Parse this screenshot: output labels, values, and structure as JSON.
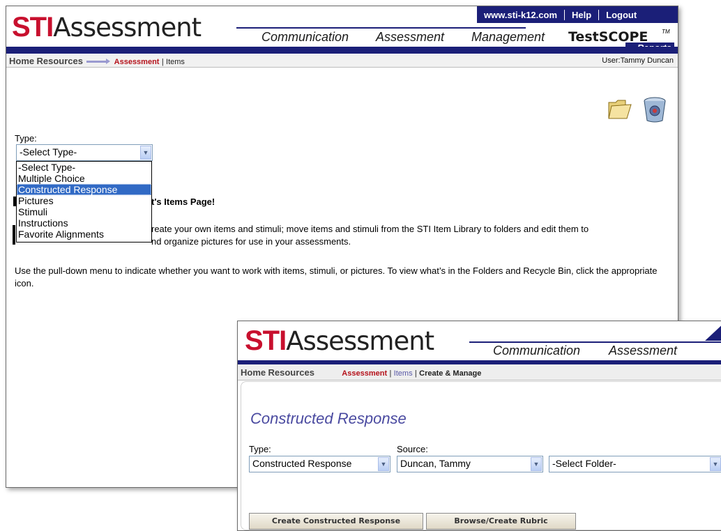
{
  "back_window": {
    "util_links": [
      "www.sti-k12.com",
      "Help",
      "Logout"
    ],
    "logo": {
      "sti": "STI",
      "assessment": "Assessment"
    },
    "top_nav": [
      "Communication",
      "Assessment",
      "Management",
      "TestSCOPE",
      "Reports"
    ],
    "trademark": "TM",
    "breadcrumb": {
      "home": "Home",
      "resources": "Resources",
      "assessment": "Assessment",
      "sep": "|",
      "items": "Items"
    },
    "user": "User:Tammy Duncan",
    "type_label": "Type:",
    "type_select_value": "-Select Type-",
    "type_options": [
      "-Select Type-",
      "Multiple Choice",
      "Constructed Response",
      "Pictures",
      "Stimuli",
      "Instructions",
      "Favorite Alignments"
    ],
    "highlighted_option": "Constructed Response",
    "welcome_partial": "t's Items Page!",
    "para1_line1": "reate your own items and stimuli; move items and stimuli from the STI Item Library to folders and edit them to",
    "para1_line2": "nd organize pictures for use in your assessments.",
    "para2": "Use the pull-down menu to indicate whether you want to work with items, stimuli, or pictures. To view what’s in the Folders and Recycle Bin, click the appropriate icon.",
    "icons": [
      "folder-icon",
      "recycle-bin-icon"
    ]
  },
  "front_window": {
    "logo": {
      "sti": "STI",
      "assessment": "Assessment"
    },
    "top_nav": [
      "Communication",
      "Assessment"
    ],
    "breadcrumb": {
      "home": "Home",
      "resources": "Resources",
      "assessment": "Assessment",
      "sep": "|",
      "items": "Items",
      "create_manage": "Create & Manage"
    },
    "heading": "Constructed Response",
    "type_label": "Type:",
    "type_value": "Constructed Response",
    "source_label": "Source:",
    "source_value": "Duncan, Tammy",
    "folder_value": "-Select Folder-",
    "buttons": [
      "Create Constructed Response",
      "Browse/Create Rubric"
    ]
  },
  "colors": {
    "brand_navy": "#1b1f78",
    "brand_red": "#c8102e",
    "highlight": "#316ac5",
    "heading_blue": "#4a4aa0"
  }
}
